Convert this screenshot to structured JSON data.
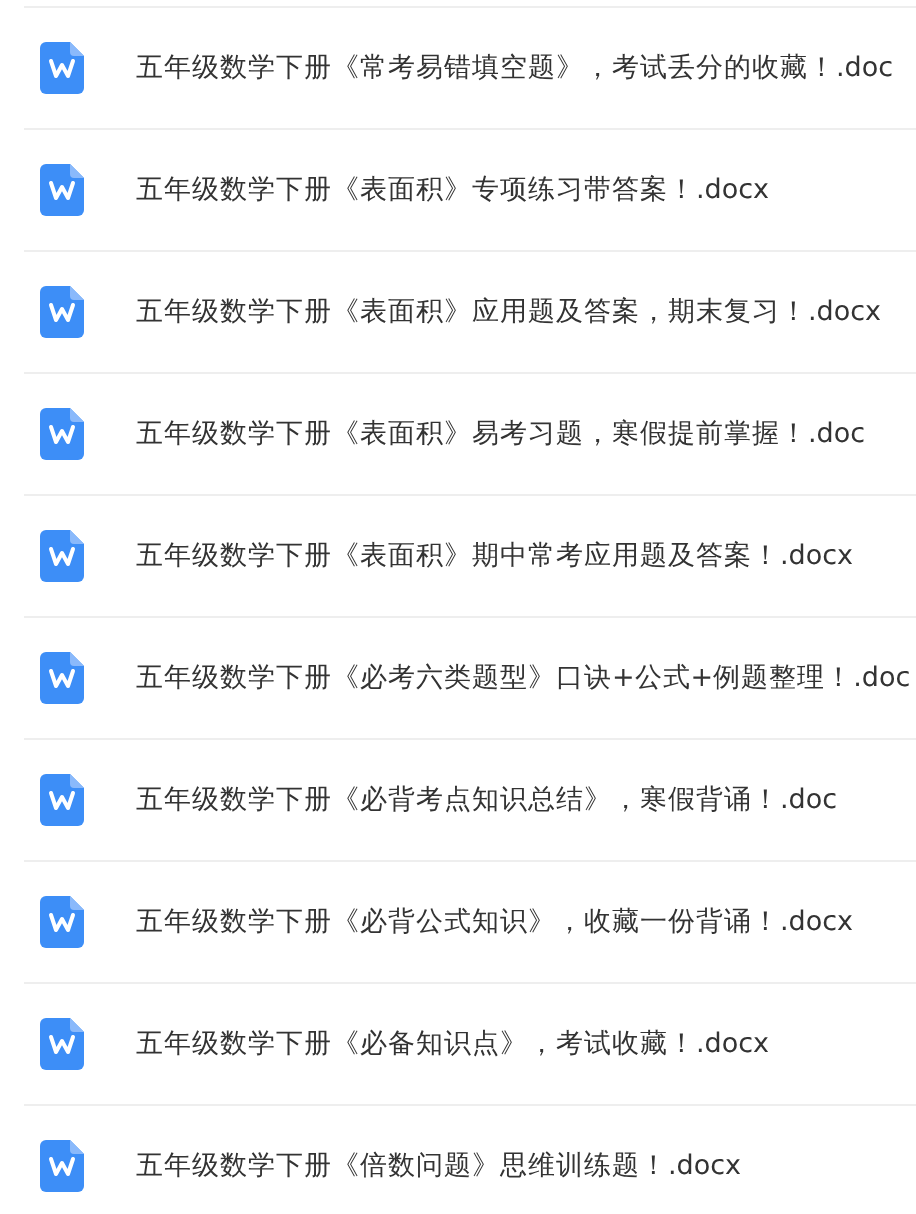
{
  "files": [
    {
      "name": "五年级数学下册《常考易错填空题》，考试丢分的收藏！.doc"
    },
    {
      "name": "五年级数学下册《表面积》专项练习带答案！.docx"
    },
    {
      "name": "五年级数学下册《表面积》应用题及答案，期末复习！.docx"
    },
    {
      "name": "五年级数学下册《表面积》易考习题，寒假提前掌握！.doc"
    },
    {
      "name": "五年级数学下册《表面积》期中常考应用题及答案！.docx"
    },
    {
      "name": "五年级数学下册《必考六类题型》口诀+公式+例题整理！.doc"
    },
    {
      "name": "五年级数学下册《必背考点知识总结》，寒假背诵！.doc"
    },
    {
      "name": "五年级数学下册《必背公式知识》，收藏一份背诵！.docx"
    },
    {
      "name": "五年级数学下册《必备知识点》，考试收藏！.docx"
    },
    {
      "name": "五年级数学下册《倍数问题》思维训练题！.docx"
    }
  ]
}
